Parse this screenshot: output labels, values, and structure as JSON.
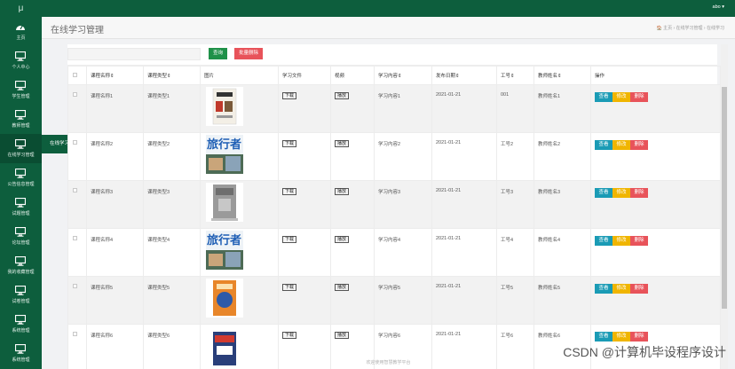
{
  "app": {
    "logo": "μ",
    "user": "abo ▾"
  },
  "sidebar": {
    "items": [
      {
        "label": "主页",
        "icon": "dashboard-icon"
      },
      {
        "label": "个人中心",
        "icon": "monitor-icon"
      },
      {
        "label": "学生管理",
        "icon": "monitor-icon"
      },
      {
        "label": "教师管理",
        "icon": "monitor-icon"
      },
      {
        "label": "在线学习管理",
        "icon": "monitor-icon"
      },
      {
        "label": "公告信息管理",
        "icon": "monitor-icon"
      },
      {
        "label": "试题管理",
        "icon": "monitor-icon"
      },
      {
        "label": "论坛管理",
        "icon": "monitor-icon"
      },
      {
        "label": "我的收藏管理",
        "icon": "monitor-icon"
      },
      {
        "label": "试卷管理",
        "icon": "monitor-icon"
      },
      {
        "label": "系统管理",
        "icon": "monitor-icon"
      },
      {
        "label": "系统管理",
        "icon": "monitor-icon"
      }
    ],
    "flyout": "在线学习"
  },
  "header": {
    "title": "在线学习管理",
    "breadcrumb": "🏠 主页 › 在线学习管理 › 在线学习"
  },
  "toolbar": {
    "search_label": "查询",
    "batch_delete_label": "批量删除"
  },
  "table": {
    "columns": [
      "课程名称⇕",
      "课程类型⇕",
      "图片",
      "学习文件",
      "视频",
      "学习内容⇕",
      "发布日期⇕",
      "工号⇕",
      "教师姓名⇕",
      "操作"
    ],
    "download_label": "下载",
    "play_label": "播放",
    "view_label": "查看",
    "edit_label": "修改",
    "delete_label": "删除",
    "rows": [
      {
        "name": "课程名称1",
        "type": "课程类型1",
        "image": "book-cover",
        "content": "学习内容1",
        "date": "2021-01-21",
        "job_no": "001",
        "teacher": "教师姓名1"
      },
      {
        "name": "课程名称2",
        "type": "课程类型2",
        "image": "travel-magazine",
        "content": "学习内容2",
        "date": "2021-01-21",
        "job_no": "工号2",
        "teacher": "教师姓名2"
      },
      {
        "name": "课程名称3",
        "type": "课程类型3",
        "image": "gray-book",
        "content": "学习内容3",
        "date": "2021-01-21",
        "job_no": "工号3",
        "teacher": "教师姓名3"
      },
      {
        "name": "课程名称4",
        "type": "课程类型4",
        "image": "travel-magazine",
        "content": "学习内容4",
        "date": "2021-01-21",
        "job_no": "工号4",
        "teacher": "教师姓名4"
      },
      {
        "name": "课程名称5",
        "type": "课程类型5",
        "image": "orange-book",
        "content": "学习内容5",
        "date": "2021-01-21",
        "job_no": "工号5",
        "teacher": "教师姓名5"
      },
      {
        "name": "课程名称6",
        "type": "课程类型6",
        "image": "red-book",
        "content": "学习内容6",
        "date": "2021-01-21",
        "job_no": "工号6",
        "teacher": "教师姓名6"
      }
    ]
  },
  "footer": {
    "text": "欢迎使用智慧教学平台"
  },
  "watermark": "CSDN @计算机毕设程序设计",
  "colors": {
    "sidebar": "#0d5e3d",
    "view": "#1a9bb5",
    "edit": "#f0b500",
    "delete": "#e8535a",
    "search": "#1f9149"
  }
}
